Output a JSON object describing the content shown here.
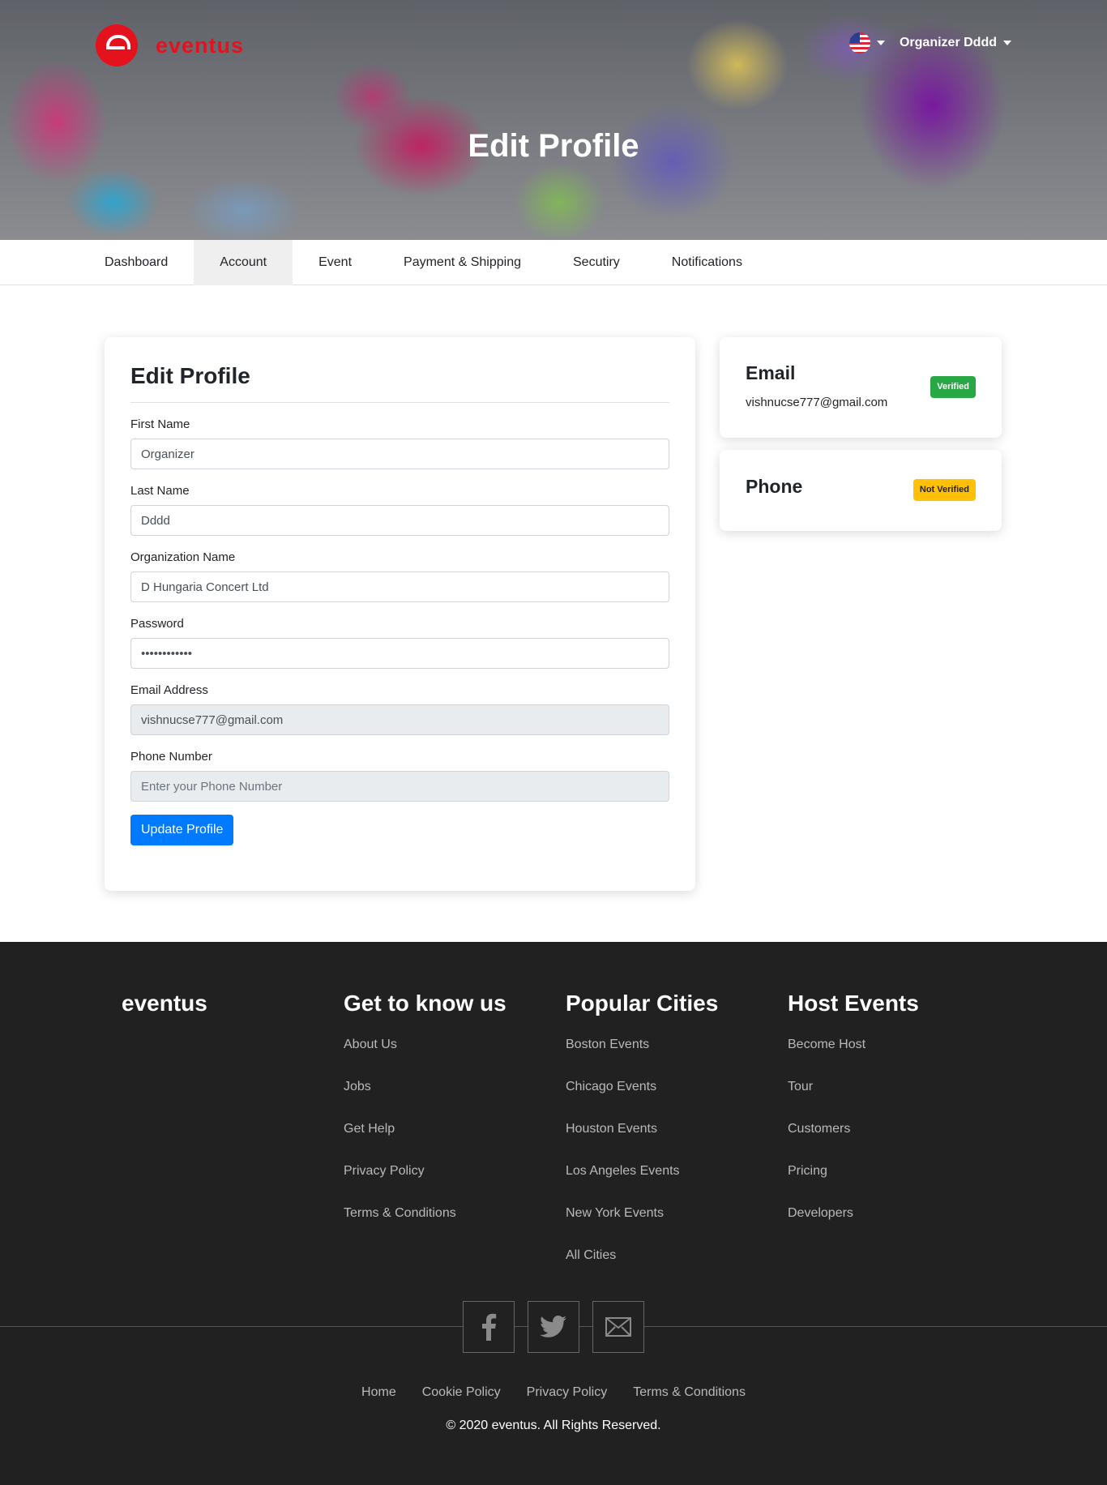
{
  "header": {
    "logo_text": "eventus",
    "user_name": "Organizer Dddd",
    "hero_title": "Edit Profile",
    "language_flag": "us-flag-icon"
  },
  "tabs": [
    {
      "label": "Dashboard",
      "active": false
    },
    {
      "label": "Account",
      "active": true
    },
    {
      "label": "Event",
      "active": false
    },
    {
      "label": "Payment & Shipping",
      "active": false
    },
    {
      "label": "Secutiry",
      "active": false
    },
    {
      "label": "Notifications",
      "active": false
    }
  ],
  "form": {
    "title": "Edit Profile",
    "first_name": {
      "label": "First Name",
      "value": "Organizer"
    },
    "last_name": {
      "label": "Last Name",
      "value": "Dddd"
    },
    "organization": {
      "label": "Organization Name",
      "value": "D Hungaria Concert Ltd"
    },
    "password": {
      "label": "Password",
      "value": "••••••••••••"
    },
    "email": {
      "label": "Email Address",
      "value": "vishnucse777@gmail.com"
    },
    "phone": {
      "label": "Phone Number",
      "placeholder": "Enter your Phone Number"
    },
    "submit_label": "Update Profile"
  },
  "verification": {
    "email": {
      "title": "Email",
      "value": "vishnucse777@gmail.com",
      "badge": "Verified",
      "badge_color": "#28a745"
    },
    "phone": {
      "title": "Phone",
      "badge": "Not Verified",
      "badge_color": "#ffc107"
    }
  },
  "footer": {
    "brand": "eventus",
    "columns": [
      {
        "heading": "Get to know us",
        "links": [
          "About Us",
          "Jobs",
          "Get Help",
          "Privacy Policy",
          "Terms & Conditions"
        ]
      },
      {
        "heading": "Popular Cities",
        "links": [
          "Boston Events",
          "Chicago Events",
          "Houston Events",
          "Los Angeles Events",
          "New York Events",
          "All Cities"
        ]
      },
      {
        "heading": "Host Events",
        "links": [
          "Become Host",
          "Tour",
          "Customers",
          "Pricing",
          "Developers"
        ]
      }
    ],
    "socials": [
      "facebook-icon",
      "twitter-icon",
      "mail-icon"
    ],
    "bottom_links": [
      "Home",
      "Cookie Policy",
      "Privacy Policy",
      "Terms & Conditions"
    ],
    "copyright": "© 2020 eventus. All Rights Reserved."
  },
  "colors": {
    "brand_red": "#e4121c",
    "primary": "#007bff",
    "footer_bg": "#212121"
  }
}
